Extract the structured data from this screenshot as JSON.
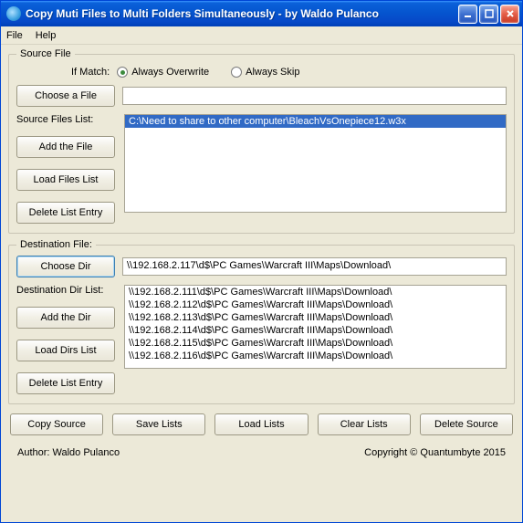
{
  "titlebar": {
    "title": "Copy Muti Files to Multi Folders Simultaneously - by Waldo Pulanco"
  },
  "menu": {
    "file": "File",
    "help": "Help"
  },
  "source": {
    "legend": "Source File",
    "if_match_label": "If Match:",
    "radio_overwrite": "Always Overwrite",
    "radio_skip": "Always Skip",
    "choose_file_btn": "Choose a File",
    "file_path": "",
    "list_label": "Source Files List:",
    "add_btn": "Add the File",
    "load_btn": "Load Files List",
    "delete_btn": "Delete List Entry",
    "items": [
      "C:\\Need to share to other computer\\BleachVsOnepiece12.w3x"
    ]
  },
  "dest": {
    "legend": "Destination File:",
    "choose_dir_btn": "Choose Dir",
    "dir_path": "\\\\192.168.2.117\\d$\\PC Games\\Warcraft III\\Maps\\Download\\",
    "list_label": "Destination Dir List:",
    "add_btn": "Add the Dir",
    "load_btn": "Load Dirs List",
    "delete_btn": "Delete List Entry",
    "items": [
      "\\\\192.168.2.111\\d$\\PC Games\\Warcraft III\\Maps\\Download\\",
      "\\\\192.168.2.112\\d$\\PC Games\\Warcraft III\\Maps\\Download\\",
      "\\\\192.168.2.113\\d$\\PC Games\\Warcraft III\\Maps\\Download\\",
      "\\\\192.168.2.114\\d$\\PC Games\\Warcraft III\\Maps\\Download\\",
      "\\\\192.168.2.115\\d$\\PC Games\\Warcraft III\\Maps\\Download\\",
      "\\\\192.168.2.116\\d$\\PC Games\\Warcraft III\\Maps\\Download\\"
    ]
  },
  "bottom": {
    "copy": "Copy Source",
    "save": "Save Lists",
    "load": "Load Lists",
    "clear": "Clear Lists",
    "delete": "Delete Source"
  },
  "footer": {
    "author": "Author: Waldo Pulanco",
    "copyright": "Copyright © Quantumbyte 2015"
  }
}
